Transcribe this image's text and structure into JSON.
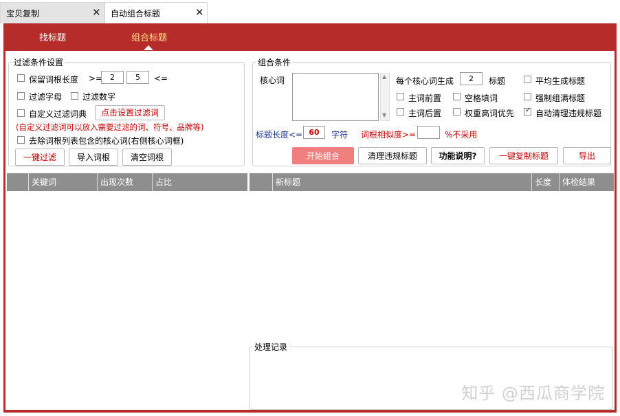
{
  "tabs": [
    {
      "label": "宝贝复制",
      "close": "✕",
      "active": false
    },
    {
      "label": "自动组合标题",
      "close": "✕",
      "active": true
    }
  ],
  "nav": {
    "items": [
      "找标题",
      "组合标题"
    ],
    "active": 1
  },
  "filter": {
    "legend": "过滤条件设置",
    "keep_root_len": {
      "label": "保留词根长度",
      "ge": ">=",
      "min": "2",
      "max": "5",
      "le": "<="
    },
    "filter_letters": "过滤字母",
    "filter_digits": "过滤数字",
    "custom_dict": "自定义过滤词典",
    "set_filter_btn": "点击设置过滤词",
    "custom_hint": "(自定义过滤词可以放入需要过滤的词、符号、品牌等)",
    "remove_core": "去除词根列表包含的核心词(右侧核心词框)",
    "buttons": {
      "one_click": "一键过滤",
      "import": "导入词根",
      "clear": "清空词根"
    }
  },
  "combo": {
    "legend": "组合条件",
    "core_label": "核心词",
    "per_core": "每个核心词生成",
    "per_core_value": "2",
    "titles_unit": "标题",
    "avg": "平均生成标题",
    "main_front": "主词前置",
    "space_fill": "空格填词",
    "force_full": "强制组满标题",
    "main_back": "主词后置",
    "weight_priority": "权重高词优先",
    "auto_clean": "自动清理违规标题",
    "title_len_label": "标题长度<=",
    "title_len": "60",
    "chars": "字符",
    "similarity_label": "词根相似度>=",
    "similarity_value": "",
    "not_used": "%不采用",
    "buttons": {
      "start": "开始组合",
      "clean": "清理违规标题",
      "help": "功能说明?",
      "copy": "一键复制标题",
      "export": "导出"
    }
  },
  "left_table": {
    "headers": [
      "",
      "关键词",
      "出现次数",
      "占比"
    ]
  },
  "right_table": {
    "headers": [
      "",
      "新标题",
      "长度",
      "体检结果"
    ]
  },
  "log": {
    "legend": "处理记录"
  },
  "watermark": "知乎 @西瓜商学院",
  "colors": {
    "frame": "#b52c2a",
    "start_btn": "#f08080",
    "header": "#8e8e8e"
  }
}
